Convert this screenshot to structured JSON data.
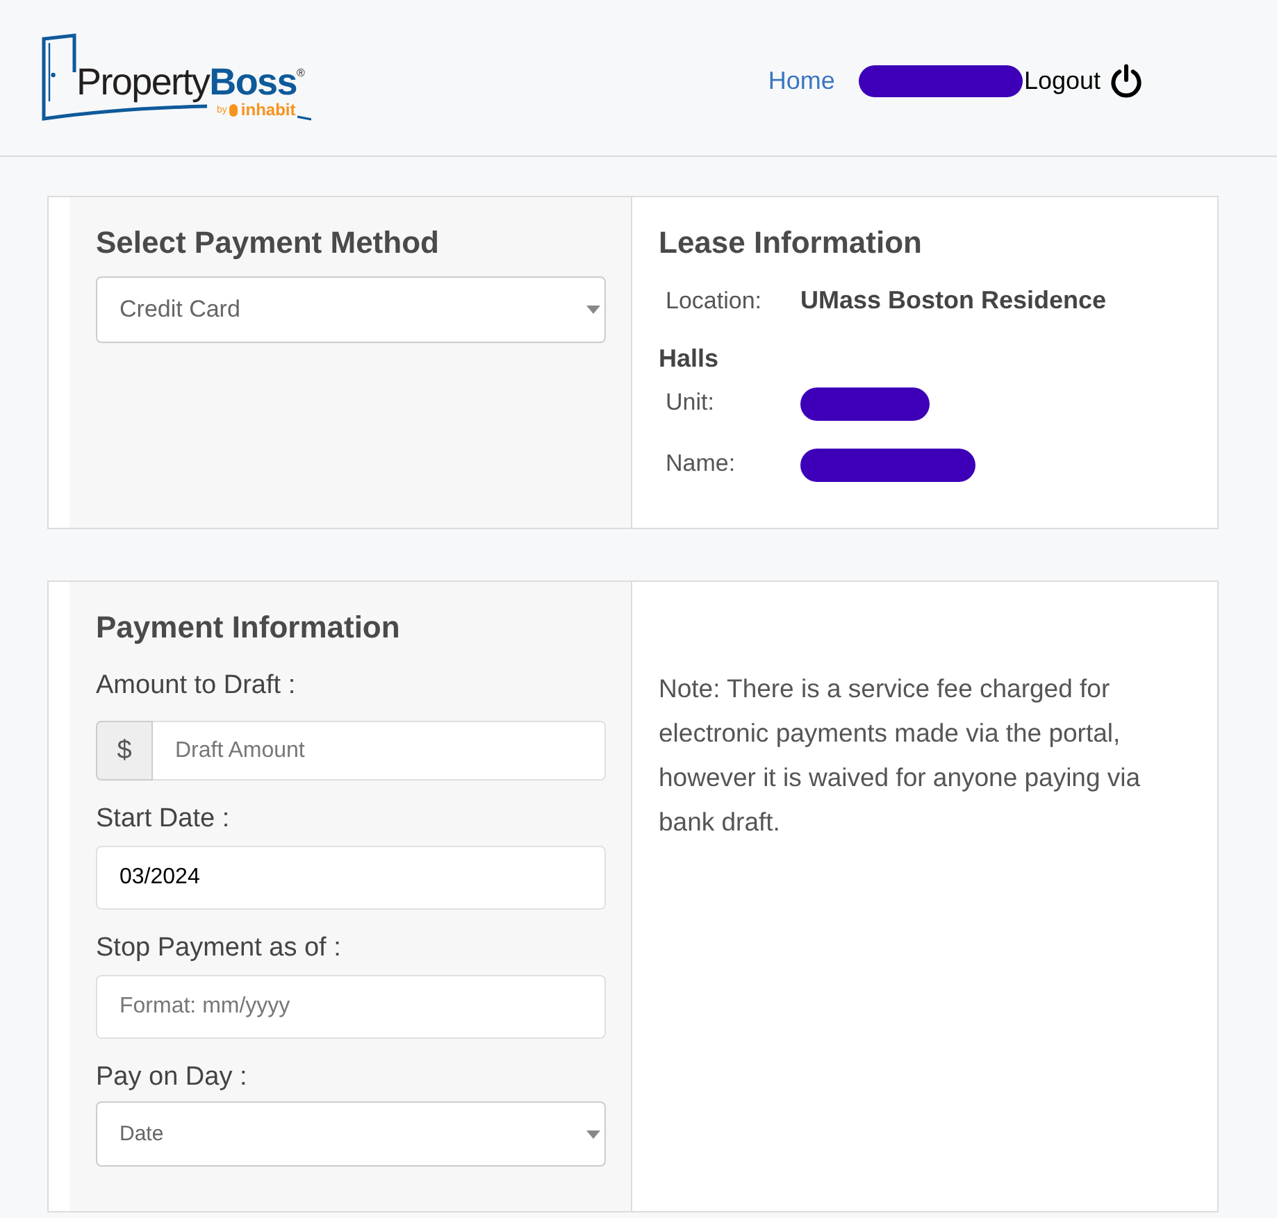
{
  "header": {
    "logo": {
      "name": "Property**Boss**$^{®}$",
      "byline": "by",
      "subbrand": "inhabit"
    },
    "nav": [
      {
        "kind": "link",
        "label": "Home"
      },
      {
        "kind": "redacted"
      },
      {
        "kind": "logout",
        "label": "Logout"
      }
    ]
  },
  "payment_method": {
    "title": "Select Payment Method",
    "select": {
      "value": "Credit Card"
    }
  },
  "lease_information": {
    "title": "Lease Information",
    "rows": [
      {
        "label": "Location:",
        "value": "UMass Boston Residence Halls",
        "redacted": false
      },
      {
        "label": "Unit:",
        "redacted": true
      },
      {
        "label": "Name:",
        "redacted": true
      }
    ]
  },
  "payment_information": {
    "title": "Payment Information",
    "fields": [
      {
        "kind": "amount",
        "label": "Amount to Draft :",
        "prefix": "$",
        "placeholder": "Draft Amount"
      },
      {
        "kind": "text",
        "label": "Start Date :",
        "value": "03/2024"
      },
      {
        "kind": "text",
        "label": "Stop Payment as of :",
        "placeholder": "Format: mm/yyyy"
      },
      {
        "kind": "select",
        "label": "Pay on Day :",
        "value": "Date"
      }
    ]
  },
  "note": "Note: There is a service fee charged for electronic payments made via the portal, however it is waived for anyone paying via bank draft."
}
